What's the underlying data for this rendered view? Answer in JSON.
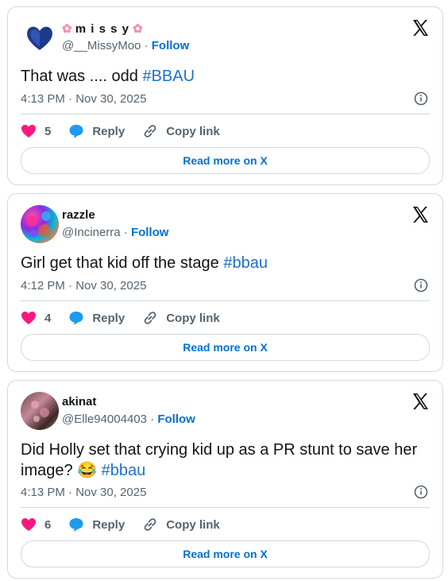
{
  "tweets": [
    {
      "name": "m i s s y",
      "handle": "@__MissyMoo",
      "follow": "Follow",
      "text": "That was .... odd",
      "hashtag": "#BBAU",
      "emoji": "",
      "timestamp": "4:13 PM · Nov 30, 2025",
      "likes": "5",
      "reply": "Reply",
      "copy_link": "Copy link",
      "read_more": "Read more on X"
    },
    {
      "name": "razzle",
      "handle": "@Incinerra",
      "follow": "Follow",
      "text": "Girl get that kid off the stage",
      "hashtag": "#bbau",
      "emoji": "",
      "timestamp": "4:12 PM · Nov 30, 2025",
      "likes": "4",
      "reply": "Reply",
      "copy_link": "Copy link",
      "read_more": "Read more on X"
    },
    {
      "name": "akinat",
      "handle": "@Elle94004403",
      "follow": "Follow",
      "text": "Did Holly set that crying kid up as a PR stunt to save her image?",
      "hashtag": "#bbau",
      "emoji": "😂",
      "timestamp": "4:13 PM · Nov 30, 2025",
      "likes": "6",
      "reply": "Reply",
      "copy_link": "Copy link",
      "read_more": "Read more on X"
    }
  ],
  "colors": {
    "link": "#006fd6",
    "hashtag": "#1d70c9",
    "heart": "#f91880",
    "reply_bubble": "#1d9bf0",
    "muted": "#536471",
    "border": "#cfd9de"
  },
  "icons": [
    "x-logo-icon",
    "info-icon",
    "heart-icon",
    "reply-icon",
    "copy-link-icon",
    "cherry-blossom-icon",
    "heart-avatar"
  ]
}
